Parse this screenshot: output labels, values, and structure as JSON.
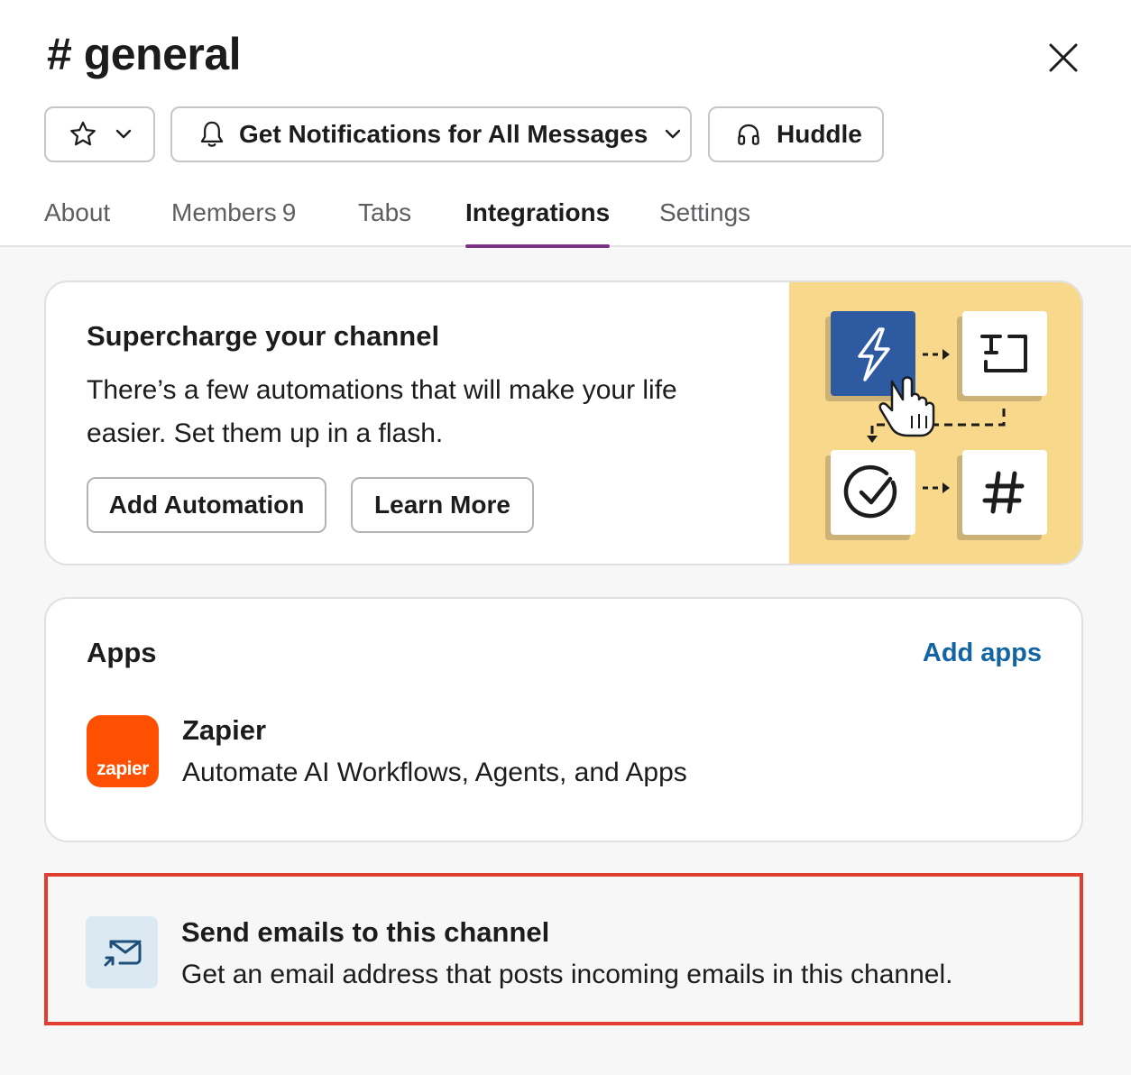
{
  "header": {
    "title": "# general",
    "close_icon": "close-icon"
  },
  "actions": {
    "star_icon": "star-icon",
    "notifications_label": "Get Notifications for All Messages",
    "huddle_label": "Huddle"
  },
  "tabs": [
    {
      "label": "About"
    },
    {
      "label": "Members",
      "count": "9"
    },
    {
      "label": "Tabs"
    },
    {
      "label": "Integrations",
      "active": true
    },
    {
      "label": "Settings"
    }
  ],
  "promo": {
    "title": "Supercharge your channel",
    "description": "There’s a few automations that will make your life easier. Set them up in a flash.",
    "add_automation_label": "Add Automation",
    "learn_more_label": "Learn More"
  },
  "apps": {
    "title": "Apps",
    "add_apps_label": "Add apps",
    "items": [
      {
        "name": "Zapier",
        "logo_text": "zapier",
        "description": "Automate AI Workflows, Agents, and Apps"
      }
    ]
  },
  "email": {
    "title": "Send emails to this channel",
    "description": "Get an email address that posts incoming emails in this channel."
  },
  "colors": {
    "accent_tab": "#7c3085",
    "link": "#1264a3",
    "highlight_border": "#e03e2f",
    "zapier_orange": "#ff4f00",
    "illustration_bg": "#f8d88a",
    "workflow_blue": "#2d5aa0"
  }
}
